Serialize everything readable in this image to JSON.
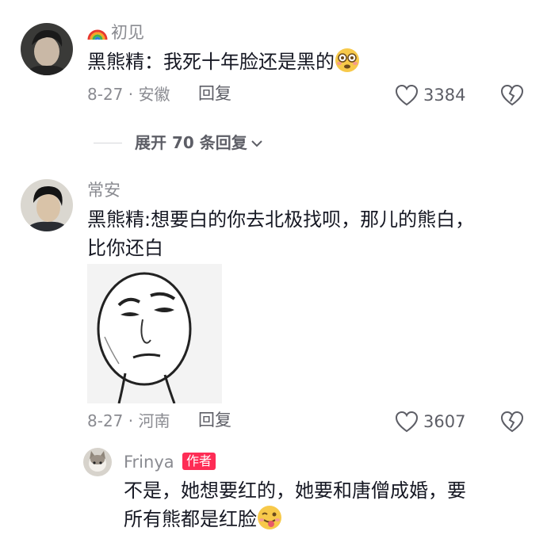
{
  "comments": [
    {
      "username": "初见",
      "text": "黑熊精：我死十年脸还是黑的",
      "meta": "8-27 · 安徽",
      "reply_label": "回复",
      "likes": "3384"
    },
    {
      "username": "常安",
      "text_line1": "黑熊精:想要白的你去北极找呗，那儿的熊白，",
      "text_line2": "比你还白",
      "meta": "8-27 · 河南",
      "reply_label": "回复",
      "likes": "3607"
    }
  ],
  "expand_replies": {
    "label": "展开 70 条回复"
  },
  "reply": {
    "username": "Frinya",
    "badge": "作者",
    "text_line1": "不是，她想要红的，她要和唐僧成婚，要",
    "text_line2": "所有熊都是红脸"
  },
  "icons": {
    "rainbow": "rainbow-icon",
    "heart": "heart-outline-icon",
    "dislike": "broken-heart-icon",
    "chevron": "chevron-down-icon",
    "emoji_dizzy": "flushed-face-emoji",
    "emoji_wink": "winking-tongue-emoji"
  },
  "colors": {
    "accent": "#fe2c55",
    "secondary_text": "#8a8b91"
  }
}
